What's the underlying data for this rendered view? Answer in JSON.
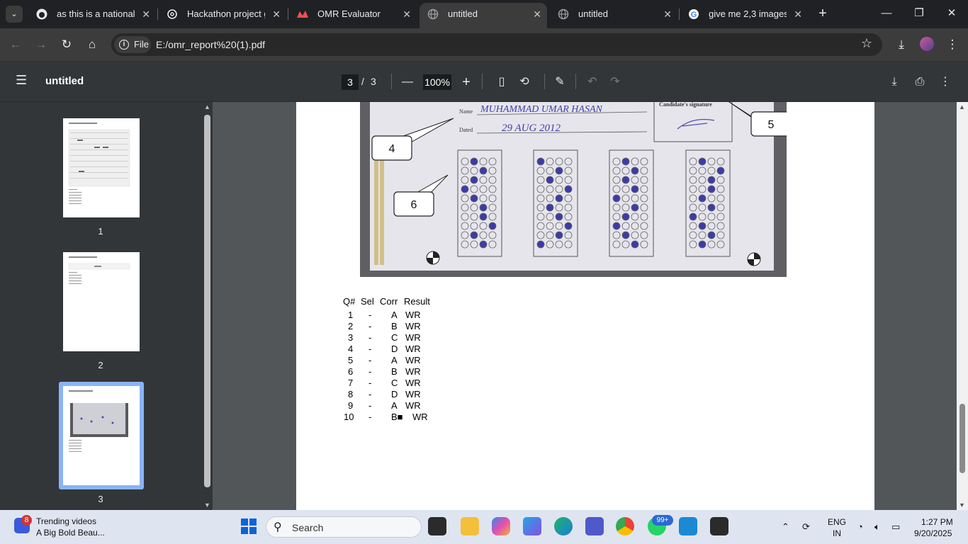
{
  "tabs": [
    {
      "title": "as this is a national ha",
      "icon": "github-icon"
    },
    {
      "title": "Hackathon project gu",
      "icon": "chatgpt-icon"
    },
    {
      "title": "OMR Evaluator",
      "icon": "streamlit-icon"
    },
    {
      "title": "untitled",
      "icon": "globe-icon",
      "active": true
    },
    {
      "title": "untitled",
      "icon": "globe-icon"
    },
    {
      "title": "give me 2,3 images o",
      "icon": "google-icon"
    }
  ],
  "omnibox": {
    "chip": "File",
    "url": "E:/omr_report%20(1).pdf"
  },
  "pdf": {
    "title": "untitled",
    "page": "3",
    "sep": "/",
    "total": "3",
    "zoom": "100%"
  },
  "thumbnails": [
    {
      "num": "1"
    },
    {
      "num": "2"
    },
    {
      "num": "3"
    }
  ],
  "omr": {
    "headers": [
      "Q#",
      "Sel",
      "Corr",
      "Result"
    ],
    "rows": [
      [
        "1",
        "-",
        "A",
        "WR"
      ],
      [
        "2",
        "-",
        "B",
        "WR"
      ],
      [
        "3",
        "-",
        "C",
        "WR"
      ],
      [
        "4",
        "-",
        "D",
        "WR"
      ],
      [
        "5",
        "-",
        "A",
        "WR"
      ],
      [
        "6",
        "-",
        "B",
        "WR"
      ],
      [
        "7",
        "-",
        "C",
        "WR"
      ],
      [
        "8",
        "-",
        "D",
        "WR"
      ],
      [
        "9",
        "-",
        "A",
        "WR"
      ],
      [
        "10",
        "-",
        "B■",
        "WR"
      ]
    ],
    "callouts": [
      "4",
      "6",
      "5"
    ],
    "sheet_text": {
      "name_label": "Name",
      "dated_label": "Dated",
      "name_value": "MUHAMMAD UMAR HASAN",
      "date_value": "29 AUG 2012",
      "signature_label": "Candidate's signature"
    }
  },
  "taskbar": {
    "news_badge": "8",
    "news_title": "Trending videos",
    "news_sub": "A Big Bold Beau...",
    "search_label": "Search",
    "whatsapp_badge": "99+",
    "lang": "ENG",
    "region": "IN",
    "time": "1:27 PM",
    "date": "9/20/2025"
  }
}
